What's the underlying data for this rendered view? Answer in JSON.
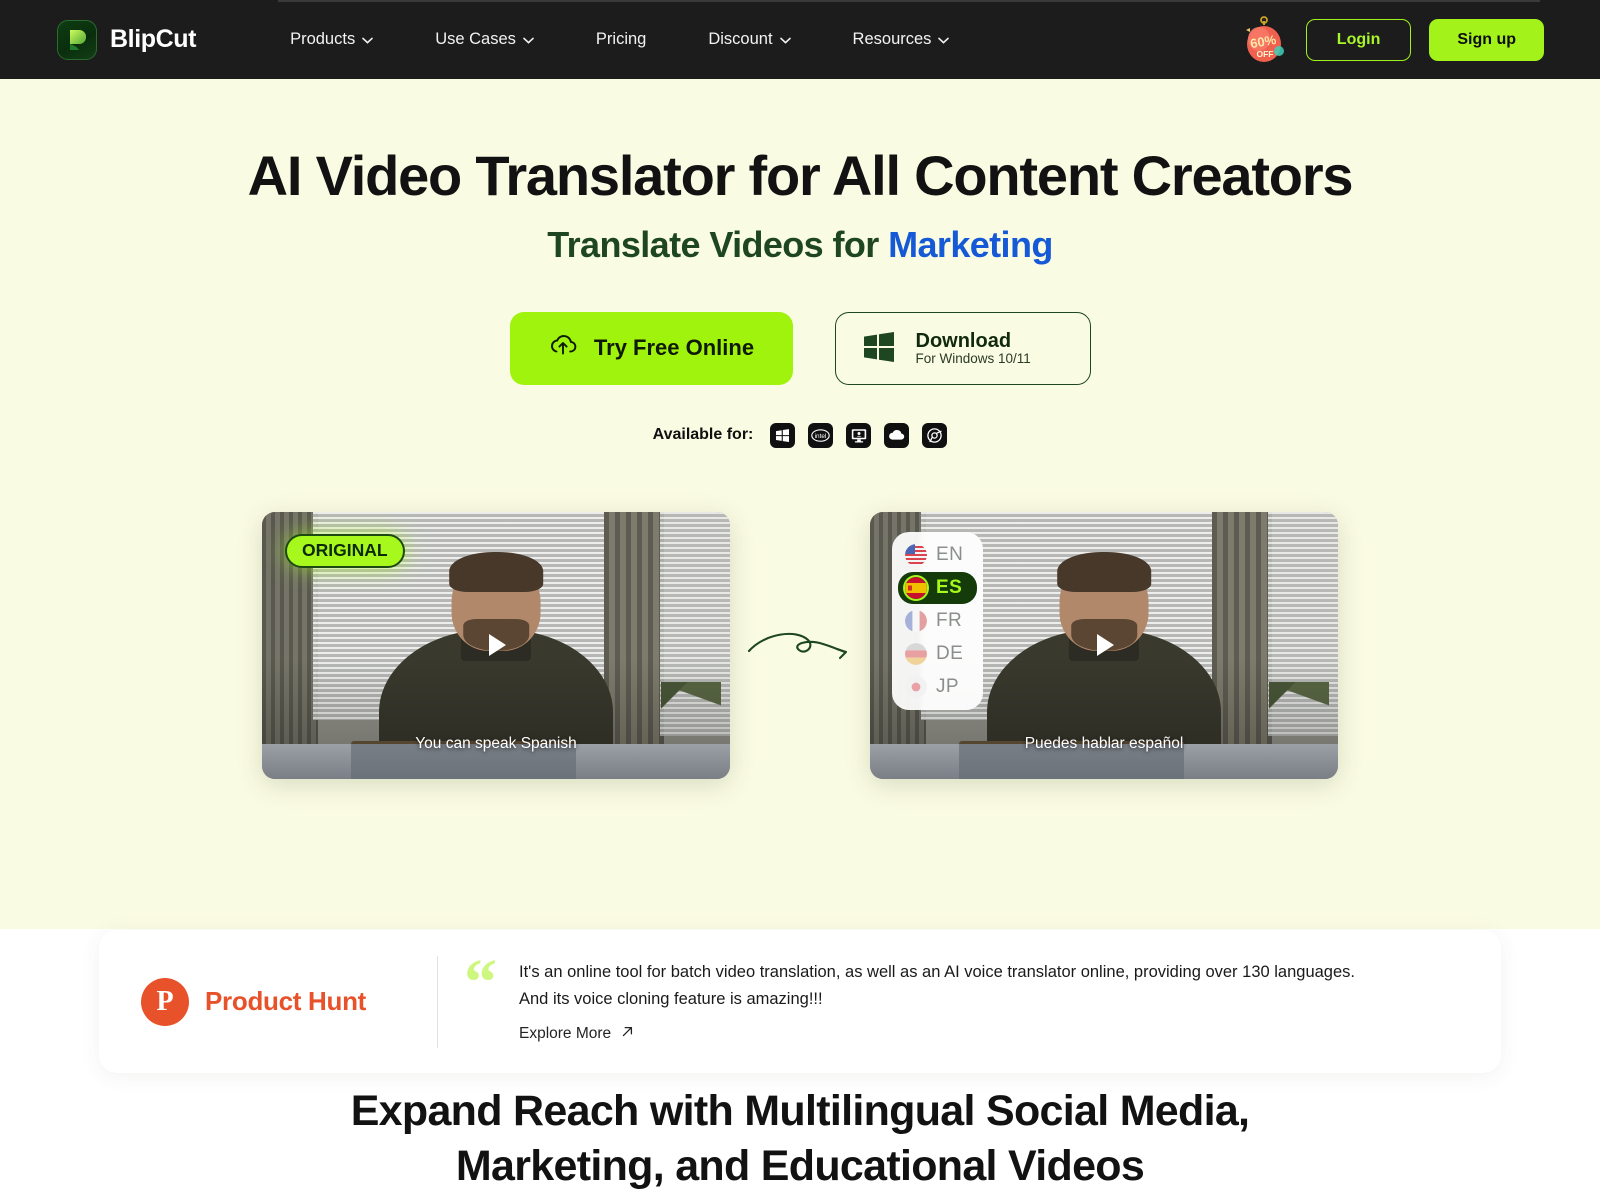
{
  "brand": {
    "name": "BlipCut",
    "logo_icon": "blipcut-leaf-logo"
  },
  "nav": {
    "items": [
      {
        "label": "Products",
        "has_dropdown": true
      },
      {
        "label": "Use Cases",
        "has_dropdown": true
      },
      {
        "label": "Pricing",
        "has_dropdown": false
      },
      {
        "label": "Discount",
        "has_dropdown": true
      },
      {
        "label": "Resources",
        "has_dropdown": true
      }
    ],
    "promo_badge": {
      "percent": "60%",
      "off": "OFF",
      "icon": "ornament-discount-badge"
    },
    "login_label": "Login",
    "signup_label": "Sign up"
  },
  "hero": {
    "title": "AI Video Translator for All Content Creators",
    "subtitle_prefix": "Translate Videos for ",
    "subtitle_accent": "Marketing",
    "cta_primary": "Try Free Online",
    "cta_primary_icon": "cloud-upload-icon",
    "cta_secondary_title": "Download",
    "cta_secondary_sub": "For Windows 10/11",
    "cta_secondary_icon": "windows-icon",
    "available_label": "Available for:",
    "platforms": [
      {
        "name": "windows-icon"
      },
      {
        "name": "intel-mac-icon"
      },
      {
        "name": "imac-desktop-icon"
      },
      {
        "name": "cloud-icon"
      },
      {
        "name": "chrome-browser-icon"
      }
    ]
  },
  "videos": {
    "original": {
      "badge": "ORIGINAL",
      "caption": "You can speak Spanish",
      "play_icon": "play-icon"
    },
    "arrow_icon": "curved-arrow-icon",
    "translated": {
      "caption": "Puedes hablar español",
      "play_icon": "play-icon",
      "languages": [
        {
          "code": "EN",
          "flag": "flag-us",
          "active": false
        },
        {
          "code": "ES",
          "flag": "flag-es",
          "active": true
        },
        {
          "code": "FR",
          "flag": "flag-fr",
          "active": false
        },
        {
          "code": "DE",
          "flag": "flag-de",
          "active": false
        },
        {
          "code": "JP",
          "flag": "flag-jp",
          "active": false
        }
      ]
    }
  },
  "testimonial": {
    "source_name": "Product Hunt",
    "source_icon": "product-hunt-logo",
    "source_letter": "P",
    "quote_icon": "quote-mark-icon",
    "line1": "It's an online tool for batch video translation, as well as an AI voice translator online, providing over 130 languages.",
    "line2": "And its voice cloning feature is amazing!!!",
    "link_label": "Explore More",
    "link_icon": "arrow-up-right-icon"
  },
  "bottom_section": {
    "heading_line1": "Expand Reach with Multilingual Social Media,",
    "heading_line2": "Marketing, and Educational Videos"
  },
  "colors": {
    "nav_bg": "#1c1c1c",
    "lime": "#a3f31b",
    "hero_bg": "#fafbe3",
    "accent_blue": "#1559d6",
    "dark_green": "#1e4620",
    "product_hunt_orange": "#e8522a"
  }
}
